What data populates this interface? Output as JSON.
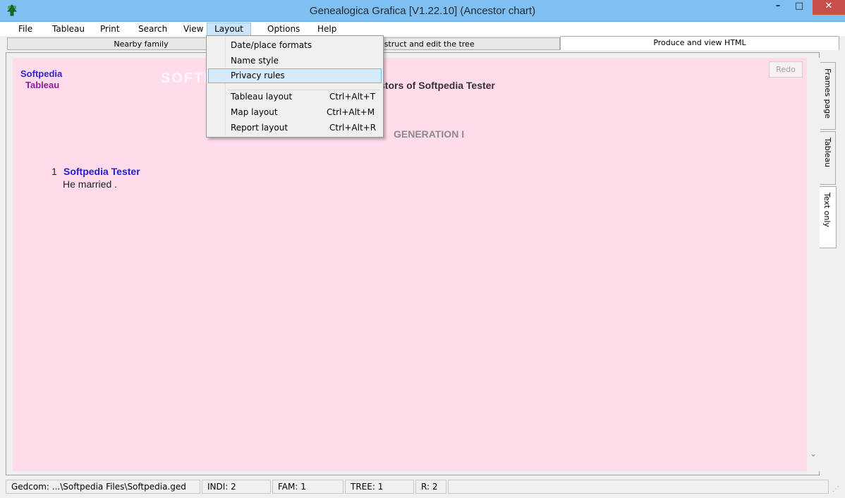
{
  "window": {
    "title": "Genealogica Grafica  [V1.22.10]   (Ancestor chart)",
    "minimize": "–",
    "maximize": "□",
    "close": "✕"
  },
  "menu": {
    "items": [
      {
        "label": "File"
      },
      {
        "label": "Tableau"
      },
      {
        "label": "Print"
      },
      {
        "label": "Search"
      },
      {
        "label": "View"
      },
      {
        "label": "Layout"
      },
      {
        "label": "Options"
      },
      {
        "label": "Help"
      }
    ]
  },
  "tabs": {
    "nearby_family": "Nearby family",
    "construct": "onstruct and edit the tree",
    "produce_html": "Produce and view HTML"
  },
  "layout_menu": {
    "items": [
      {
        "label": "Date/place formats",
        "shortcut": ""
      },
      {
        "label": "Name style",
        "shortcut": ""
      },
      {
        "label": "Privacy rules",
        "shortcut": ""
      },
      {
        "label": "Tableau layout",
        "shortcut": "Ctrl+Alt+T"
      },
      {
        "label": "Map layout",
        "shortcut": "Ctrl+Alt+M"
      },
      {
        "label": "Report layout",
        "shortcut": "Ctrl+Alt+R"
      }
    ]
  },
  "content": {
    "logo_line1": "Softpedia",
    "logo_line2": "Tableau",
    "watermark": "SOFTPEDIA",
    "redo_label": "Redo",
    "chart_title": "stors of Softpedia Tester",
    "generation": "GENERATION I",
    "person_number": "1",
    "person_name": "Softpedia Tester",
    "person_desc": "He married ."
  },
  "side_tabs": {
    "frames_page": "Frames page",
    "tableau": "Tableau",
    "text_only": "Text only"
  },
  "status": {
    "gedcom": "Gedcom: ...\\Softpedia Files\\Softpedia.ged",
    "indi": "INDI:  2",
    "fam": "FAM:  1",
    "tree": "TREE:  1",
    "r": "R:  2"
  },
  "colors": {
    "titlebar": "#7fbff2",
    "content_bg": "#ffdbec",
    "logo_blue": "#2a25cf",
    "logo_purple": "#8c1f9a",
    "name_blue": "#1f1fd4",
    "highlight": "#d8eaf9"
  },
  "icons": {
    "app": "tree-icon",
    "scroll_down": "chevron-down-icon"
  }
}
